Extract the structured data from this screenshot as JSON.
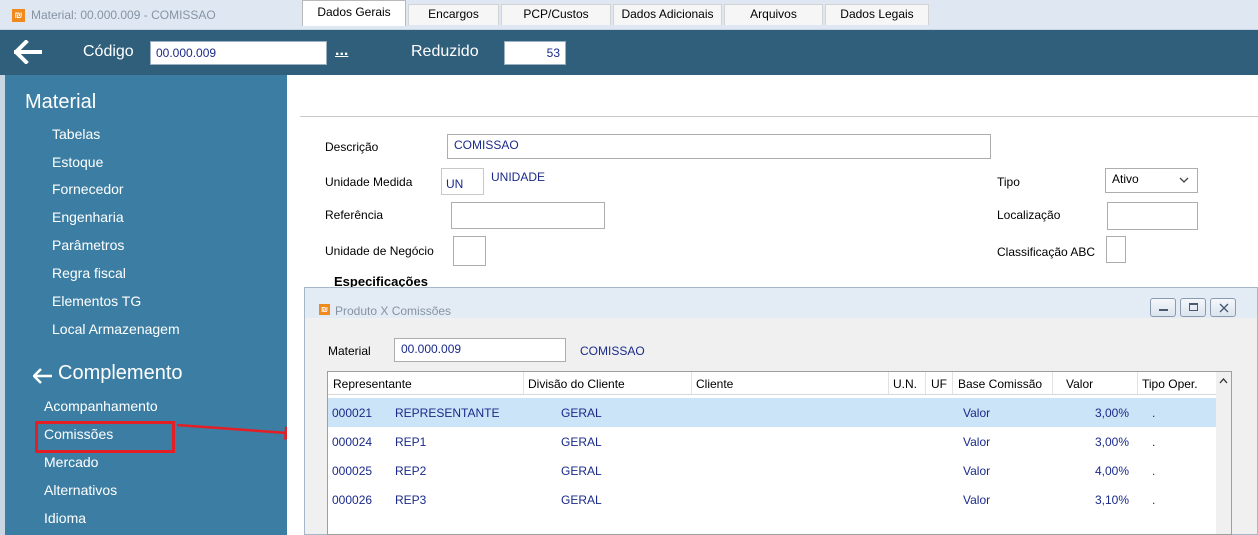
{
  "window": {
    "title": "Material: 00.000.009 - COMISSAO"
  },
  "header": {
    "codigo_label": "Código",
    "codigo_value": "00.000.009",
    "ellipsis": "...",
    "reduzido_label": "Reduzido",
    "reduzido_value": "53"
  },
  "sidebar": {
    "section1_title": "Material",
    "section1_items": [
      "Tabelas",
      "Estoque",
      "Fornecedor",
      "Engenharia",
      "Parâmetros",
      "Regra fiscal",
      "Elementos TG",
      "Local Armazenagem"
    ],
    "section2_title": "Complemento",
    "section2_items": [
      "Acompanhamento",
      "Comissões",
      "Mercado",
      "Alternativos",
      "Idioma"
    ],
    "highlighted_item": "Comissões"
  },
  "tabs": [
    "Dados Gerais",
    "Encargos",
    "PCP/Custos",
    "Dados Adicionais",
    "Arquivos",
    "Dados Legais"
  ],
  "active_tab": "Dados Gerais",
  "form": {
    "descricao_label": "Descrição",
    "descricao_value": "COMISSAO",
    "unidade_label": "Unidade Medida",
    "unidade_code": "UN",
    "unidade_name": "UNIDADE",
    "referencia_label": "Referência",
    "referencia_value": "",
    "unidade_negocio_label": "Unidade de Negócio",
    "unidade_negocio_value": "",
    "tipo_label": "Tipo",
    "tipo_value": "Ativo",
    "localizacao_label": "Localização",
    "localizacao_value": "",
    "classificacao_label": "Classificação ABC",
    "classificacao_value": "",
    "especificacoes_label": "Especificações"
  },
  "subwindow": {
    "title": "Produto X Comissões",
    "material_label": "Material",
    "material_value": "00.000.009",
    "material_name": "COMISSAO",
    "columns": [
      "Representante",
      "Divisão do Cliente",
      "Cliente",
      "U.N.",
      "UF",
      "Base Comissão",
      "Valor",
      "Tipo Oper."
    ],
    "rows": [
      {
        "code": "000021",
        "name": "REPRESENTANTE",
        "divisao": "GERAL",
        "cliente": "",
        "un": "",
        "uf": "",
        "base": "Valor",
        "valor": "3,00%",
        "tipo": "."
      },
      {
        "code": "000024",
        "name": "REP1",
        "divisao": "GERAL",
        "cliente": "",
        "un": "",
        "uf": "",
        "base": "Valor",
        "valor": "3,00%",
        "tipo": "."
      },
      {
        "code": "000025",
        "name": "REP2",
        "divisao": "GERAL",
        "cliente": "",
        "un": "",
        "uf": "",
        "base": "Valor",
        "valor": "4,00%",
        "tipo": "."
      },
      {
        "code": "000026",
        "name": "REP3",
        "divisao": "GERAL",
        "cliente": "",
        "un": "",
        "uf": "",
        "base": "Valor",
        "valor": "3,10%",
        "tipo": "."
      }
    ]
  },
  "colors": {
    "header_bg": "#2f5f7b",
    "sidebar_bg": "#3c7ea3",
    "value_text": "#1a2a8a",
    "selected_row": "#cce4f7",
    "annotation_red": "#e31e24"
  },
  "icons": {
    "back": "arrow-left-icon",
    "app": "app-logo-icon",
    "minimize": "minimize-icon",
    "maximize": "maximize-icon",
    "close": "close-icon",
    "dropdown": "chevron-down-icon",
    "scroll_up": "chevron-up-icon"
  }
}
